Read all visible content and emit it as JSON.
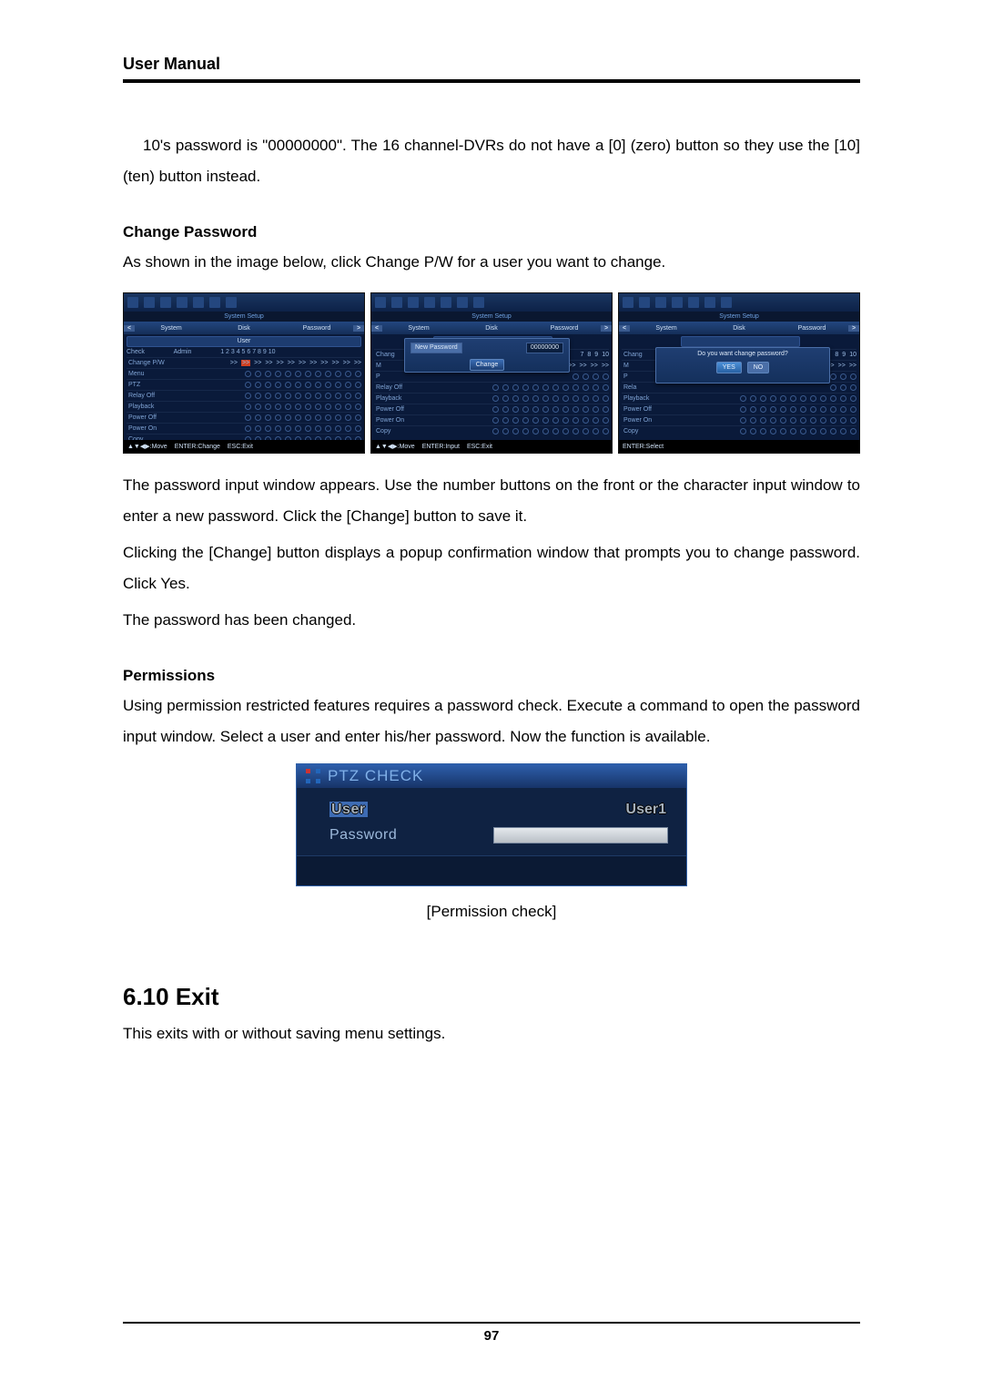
{
  "header": {
    "title": "User Manual"
  },
  "intro_paragraph": "10's password is \"00000000\". The 16 channel-DVRs do not have a [0] (zero) button so they use the [10] (ten) button instead.",
  "change_password": {
    "heading": "Change Password",
    "lead": "As shown in the image below, click Change P/W for a user you want to change.",
    "paras": [
      "The password input window appears. Use the number buttons on the front or the character input window to enter a new password. Click the [Change] button to save it.",
      "Clicking the [Change] button displays a popup confirmation window that prompts you to change password. Click Yes.",
      "The password has been changed."
    ]
  },
  "dvr": {
    "heading_bar": "System Setup",
    "tab_left": "System",
    "tab_mid": "Disk",
    "tab_right": "Password",
    "sub_header": "User",
    "cols": {
      "check": "Check",
      "admin": "Admin",
      "nums": [
        "1",
        "2",
        "3",
        "4",
        "5",
        "6",
        "7",
        "8",
        "9",
        "10"
      ]
    },
    "rows": [
      "Change P/W",
      "Menu",
      "PTZ",
      "Relay Off",
      "Playback",
      "Power Off",
      "Power On",
      "Copy"
    ],
    "status_1": {
      "move": "▲▼◀▶:Move",
      "enter": "ENTER:Change",
      "esc": "ESC:Exit"
    },
    "status_2": {
      "move": "▲▼◀▶:Move",
      "enter": "ENTER:Input",
      "esc": "ESC:Exit"
    },
    "status_3": {
      "enter": "ENTER:Select"
    },
    "popup2": {
      "label": "New Password",
      "value": "00000000",
      "button": "Change"
    },
    "popup3": {
      "text": "Do you want change password?",
      "yes": "YES",
      "no": "NO"
    }
  },
  "permissions": {
    "heading": "Permissions",
    "text": "Using permission restricted features requires a password check. Execute a command to open the password input window. Select a user and enter his/her password. Now the function is available.",
    "ptz": {
      "title": "PTZ CHECK",
      "user_label": "User",
      "user_value": "User1",
      "password_label": "Password"
    },
    "caption": "[Permission check]"
  },
  "exit": {
    "heading": "6.10  Exit",
    "text": "This exits with or without saving menu settings."
  },
  "page_number": "97"
}
